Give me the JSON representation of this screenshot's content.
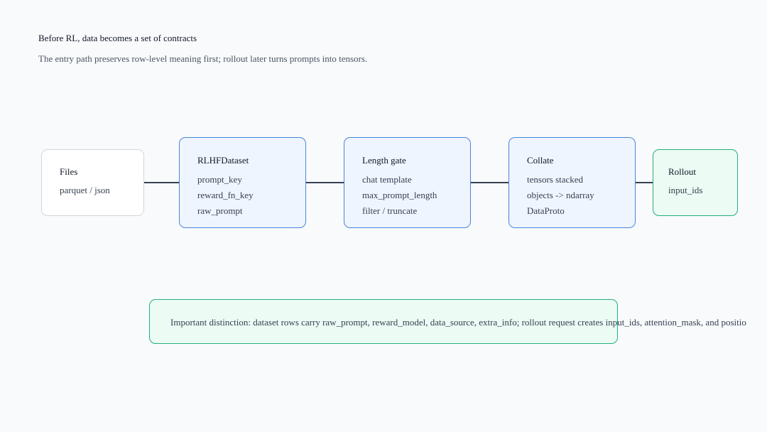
{
  "header": {
    "title": "Before RL, data becomes a set of contracts",
    "subtitle": "The entry path preserves row-level meaning first; rollout later turns prompts into tensors."
  },
  "nodes": [
    {
      "id": "files",
      "title": "Files",
      "lines": [
        "parquet / json"
      ],
      "style": "neutral"
    },
    {
      "id": "rlhf-dataset",
      "title": "RLHFDataset",
      "lines": [
        "prompt_key",
        "reward_fn_key",
        "raw_prompt"
      ],
      "style": "blue"
    },
    {
      "id": "length-gate",
      "title": "Length gate",
      "lines": [
        "chat template",
        "max_prompt_length",
        "filter / truncate"
      ],
      "style": "blue"
    },
    {
      "id": "collate",
      "title": "Collate",
      "lines": [
        "tensors stacked",
        "objects -> ndarray",
        "DataProto"
      ],
      "style": "blue"
    },
    {
      "id": "rollout",
      "title": "Rollout",
      "lines": [
        "input_ids"
      ],
      "style": "green"
    }
  ],
  "edges": [
    {
      "from": "files",
      "to": "rlhf-dataset"
    },
    {
      "from": "rlhf-dataset",
      "to": "length-gate"
    },
    {
      "from": "length-gate",
      "to": "collate"
    },
    {
      "from": "collate",
      "to": "rollout"
    }
  ],
  "note": {
    "text": "Important distinction: dataset rows carry raw_prompt, reward_model, data_source, extra_info; rollout request creates input_ids, attention_mask, and positio"
  },
  "colors": {
    "background": "#f8fafc",
    "blue_border": "#4a84d9",
    "blue_fill": "#eef5fe",
    "green_border": "#22b07d",
    "green_fill": "#ecfbf4",
    "neutral_border": "#d1d5db",
    "connector": "#374151"
  }
}
